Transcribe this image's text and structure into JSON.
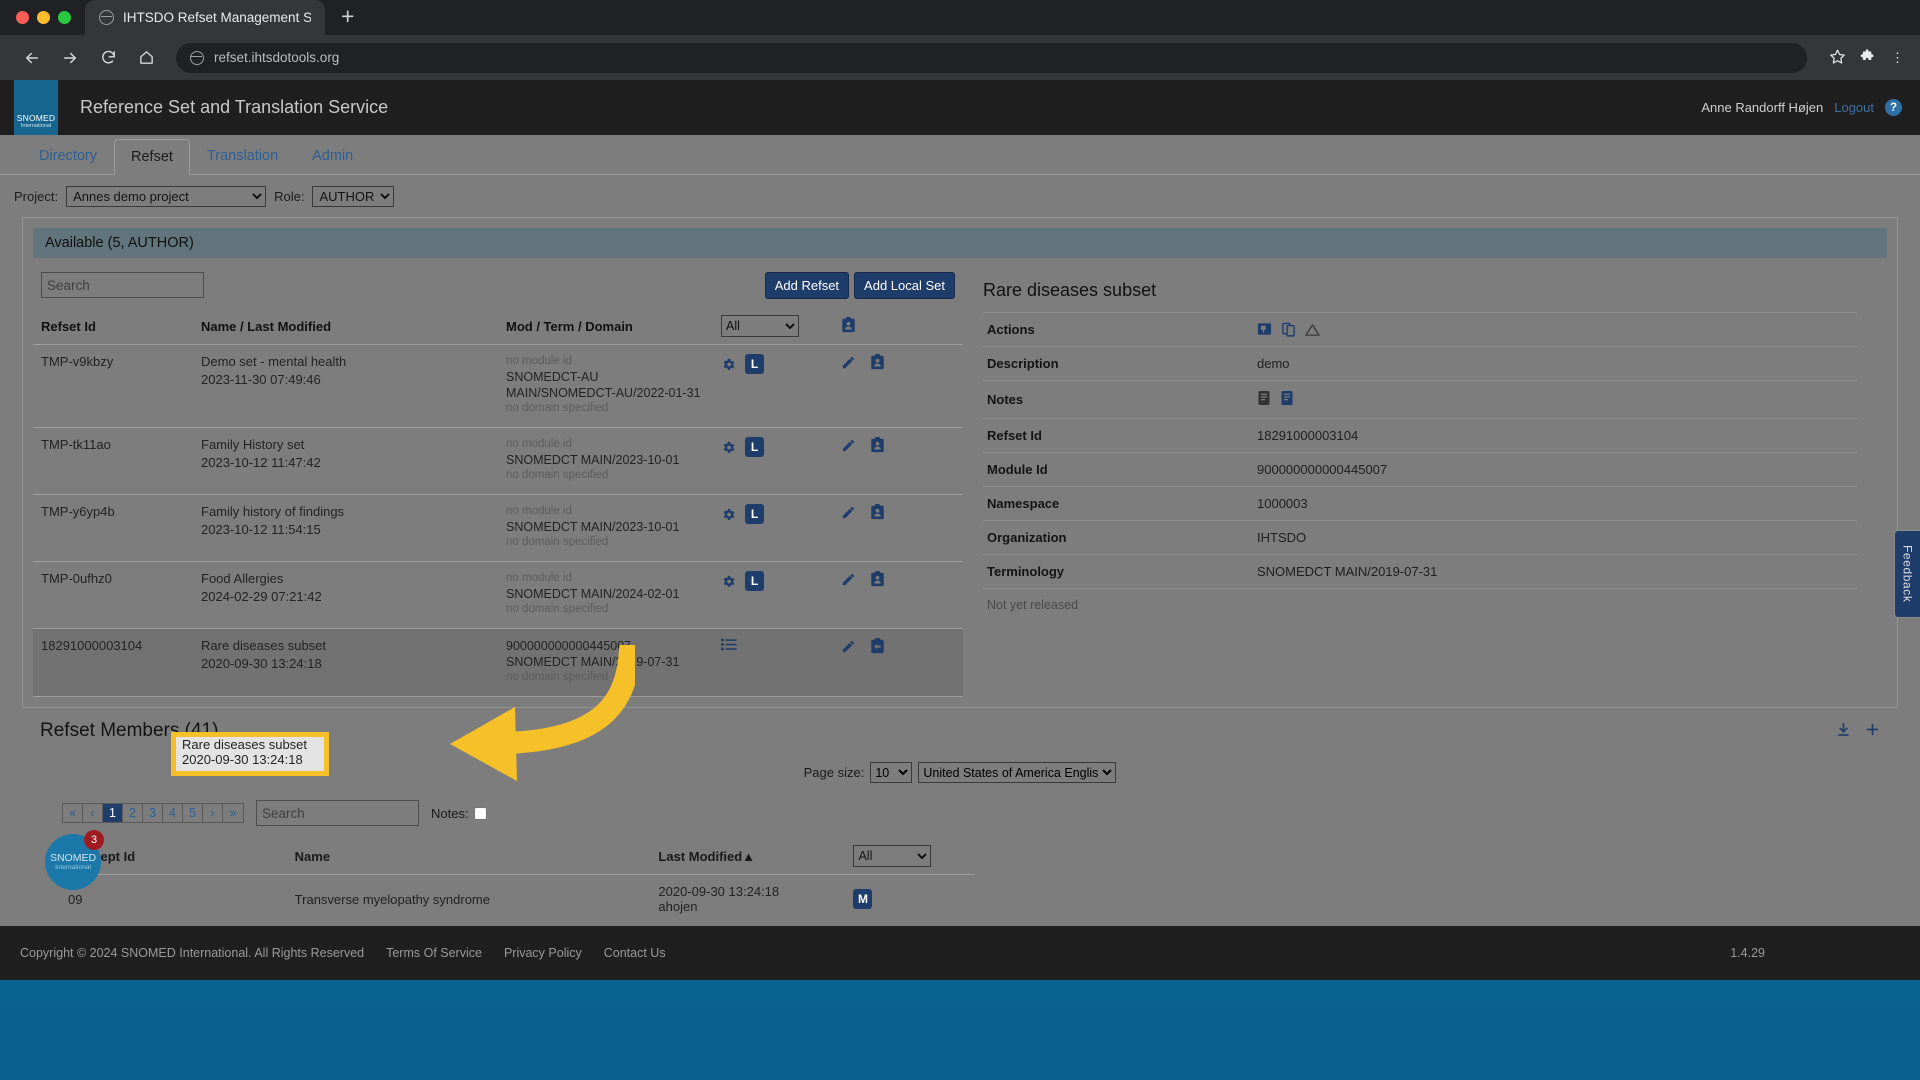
{
  "browser": {
    "tab_title": "IHTSDO Refset Management Ser",
    "new_tab_label": "+",
    "url": "refset.ihtsdotools.org",
    "nav": {
      "back": "←",
      "forward": "→",
      "reload": "⟳",
      "home": "⌂"
    },
    "icons": {
      "bookmark": "☆",
      "extensions": "puzzle-icon",
      "menu": "⋮"
    }
  },
  "header": {
    "logo_line1": "SNOMED",
    "logo_line2": "International",
    "title": "Reference Set and Translation Service",
    "user": "Anne Randorff Højen",
    "logout": "Logout",
    "help": "?"
  },
  "tabs": [
    {
      "label": "Directory",
      "active": false
    },
    {
      "label": "Refset",
      "active": true
    },
    {
      "label": "Translation",
      "active": false
    },
    {
      "label": "Admin",
      "active": false
    }
  ],
  "filters": {
    "project_label": "Project:",
    "project_value": "Annes demo project",
    "role_label": "Role:",
    "role_value": "AUTHOR"
  },
  "available": {
    "panel_title": "Available (5, AUTHOR)",
    "search_placeholder": "Search",
    "add_refset": "Add Refset",
    "add_local_set": "Add Local Set",
    "filter_all": "All",
    "columns": [
      "Refset Id",
      "Name / Last Modified",
      "Mod / Term / Domain"
    ],
    "rows": [
      {
        "refset_id": "TMP-v9kbzy",
        "name": "Demo set - mental health",
        "modified": "2023-11-30 07:49:46",
        "module": "no module id",
        "terminology": "SNOMEDCT-AU MAIN/SNOMEDCT-AU/2022-01-31",
        "domain": "no domain specified",
        "has_gear": true,
        "badge": "L",
        "selected": false
      },
      {
        "refset_id": "TMP-tk11ao",
        "name": "Family History set",
        "modified": "2023-10-12 11:47:42",
        "module": "no module id",
        "terminology": "SNOMEDCT MAIN/2023-10-01",
        "domain": "no domain specified",
        "has_gear": true,
        "badge": "L",
        "selected": false
      },
      {
        "refset_id": "TMP-y6yp4b",
        "name": "Family history of findings",
        "modified": "2023-10-12 11:54:15",
        "module": "no module id",
        "terminology": "SNOMEDCT MAIN/2023-10-01",
        "domain": "no domain specified",
        "has_gear": true,
        "badge": "L",
        "selected": false
      },
      {
        "refset_id": "TMP-0ufhz0",
        "name": "Food Allergies",
        "modified": "2024-02-29 07:21:42",
        "module": "no module id",
        "terminology": "SNOMEDCT MAIN/2024-02-01",
        "domain": "no domain specified",
        "has_gear": true,
        "badge": "L",
        "selected": false
      },
      {
        "refset_id": "18291000003104",
        "name": "Rare diseases subset",
        "modified": "2020-09-30 13:24:18",
        "module": "900000000000445007",
        "terminology": "SNOMEDCT MAIN/2019-07-31",
        "domain": "no domain specified",
        "has_gear": false,
        "badge": "",
        "selected": true
      }
    ]
  },
  "detail": {
    "title": "Rare diseases subset",
    "rows": [
      {
        "key": "Actions",
        "value": "",
        "type": "icons"
      },
      {
        "key": "Description",
        "value": "demo",
        "type": "text"
      },
      {
        "key": "Notes",
        "value": "",
        "type": "notes"
      },
      {
        "key": "Refset Id",
        "value": "18291000003104",
        "type": "text"
      },
      {
        "key": "Module Id",
        "value": "900000000000445007",
        "type": "text"
      },
      {
        "key": "Namespace",
        "value": "1000003",
        "type": "text"
      },
      {
        "key": "Organization",
        "value": "IHTSDO",
        "type": "text"
      },
      {
        "key": "Terminology",
        "value": "SNOMEDCT MAIN/2019-07-31",
        "type": "text"
      }
    ],
    "release_status": "Not yet released"
  },
  "members": {
    "title": "Refset Members (41)",
    "page_size_label": "Page size:",
    "page_size_value": "10",
    "language_value": "United States of America English",
    "pager": [
      "«",
      "‹",
      "1",
      "2",
      "3",
      "4",
      "5",
      "›",
      "»"
    ],
    "current_page": "1",
    "search_placeholder": "Search",
    "notes_label": "Notes:",
    "columns": [
      "Concept Id",
      "Name",
      "Last Modified▲",
      "All"
    ],
    "rows": [
      {
        "concept_id": "09",
        "name": "Transverse myelopathy syndrome",
        "last_modified": "2020-09-30 13:24:18",
        "author": "ahojen",
        "badge": "M"
      }
    ]
  },
  "footer": {
    "copyright": "Copyright © 2024 SNOMED International. All Rights Reserved",
    "links": [
      "Terms Of Service",
      "Privacy Policy",
      "Contact Us"
    ],
    "version": "1.4.29"
  },
  "widgets": {
    "feedback": "Feedback",
    "chat_logo1": "SNOMED",
    "chat_logo2": "International",
    "chat_badge": "3"
  },
  "annotation": {
    "highlight_line1": "Rare diseases subset",
    "highlight_line2": "2020-09-30 13:24:18",
    "arrow_color": "#f6c028"
  }
}
